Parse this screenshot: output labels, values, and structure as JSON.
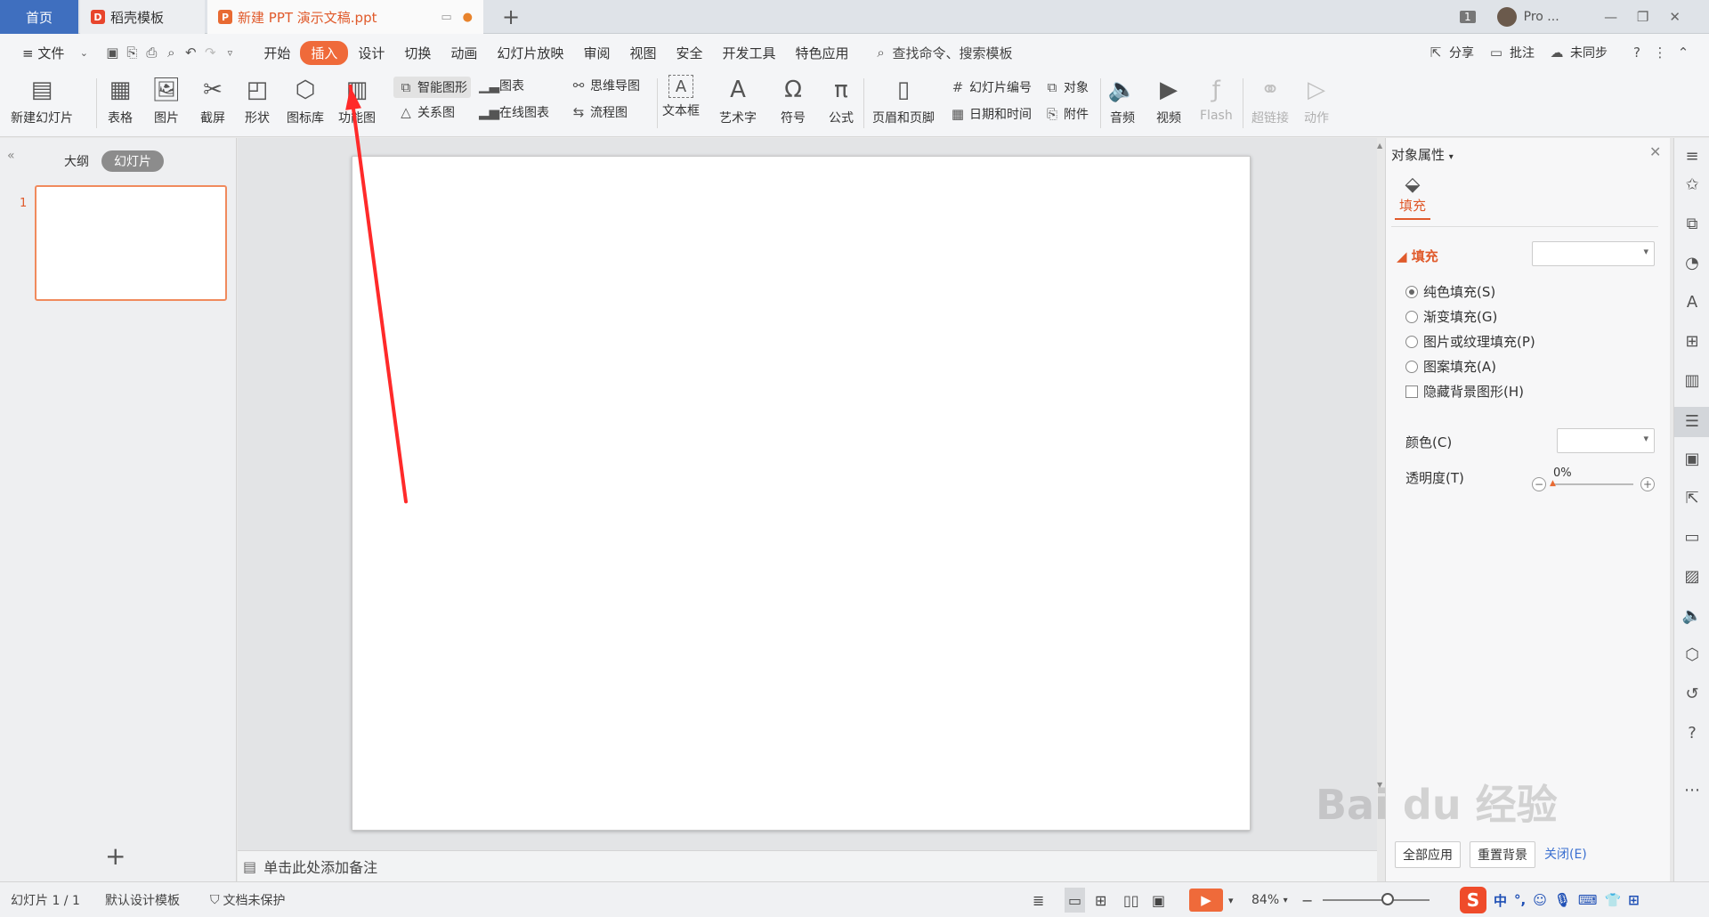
{
  "tabs": {
    "home": "首页",
    "docer": "稻壳模板",
    "doc": "新建 PPT 演示文稿.ppt",
    "new_tab": "+"
  },
  "titlebar": {
    "page_badge": "1",
    "user_name": "Pro ...",
    "minimize": "—",
    "restore": "❐",
    "close": "✕"
  },
  "menubar": {
    "file": "≡ 文件",
    "items": [
      "开始",
      "插入",
      "设计",
      "切换",
      "动画",
      "幻灯片放映",
      "审阅",
      "视图",
      "安全",
      "开发工具",
      "特色应用"
    ],
    "active_index": 1,
    "search": "查找命令、搜索模板",
    "share": "分享",
    "comment": "批注",
    "sync": "未同步"
  },
  "ribbon": {
    "new_slide": "新建幻灯片",
    "table": "表格",
    "picture": "图片",
    "screenshot": "截屏",
    "shape": "形状",
    "icon_lib": "图标库",
    "func_chart": "功能图",
    "smart_art": "智能图形",
    "relation": "关系图",
    "chart": "图表",
    "online_chart": "在线图表",
    "mindmap": "思维导图",
    "flowchart": "流程图",
    "textbox": "文本框",
    "wordart": "艺术字",
    "symbol": "符号",
    "formula": "公式",
    "header_footer": "页眉和页脚",
    "slide_number": "幻灯片编号",
    "object": "对象",
    "date_time": "日期和时间",
    "attachment": "附件",
    "audio": "音频",
    "video": "视频",
    "flash": "Flash",
    "hyperlink": "超链接",
    "action": "动作"
  },
  "leftpane": {
    "outline": "大纲",
    "slides": "幻灯片",
    "slide_number": "1",
    "add": "+"
  },
  "notes": {
    "placeholder": "单击此处添加备注"
  },
  "props": {
    "title": "对象属性",
    "tab_fill": "填充",
    "section_fill": "填充",
    "options": [
      "纯色填充(S)",
      "渐变填充(G)",
      "图片或纹理填充(P)",
      "图案填充(A)"
    ],
    "hide_bg": "隐藏背景图形(H)",
    "color_label": "颜色(C)",
    "opacity_label": "透明度(T)",
    "opacity_value": "0%",
    "apply_all": "全部应用",
    "reset_bg": "重置背景",
    "close_link": "关闭(E)"
  },
  "statusbar": {
    "slide_info": "幻灯片 1 / 1",
    "template": "默认设计模板",
    "protection": "文档未保护",
    "zoom": "84%"
  },
  "ime": {
    "logo": "S",
    "lang": "中"
  },
  "watermark": "Bai du 经验",
  "annotation": {
    "color": "#ff2a2a",
    "start": [
      0.2375,
      0.547
    ],
    "end": [
      0.205,
      0.094
    ]
  }
}
